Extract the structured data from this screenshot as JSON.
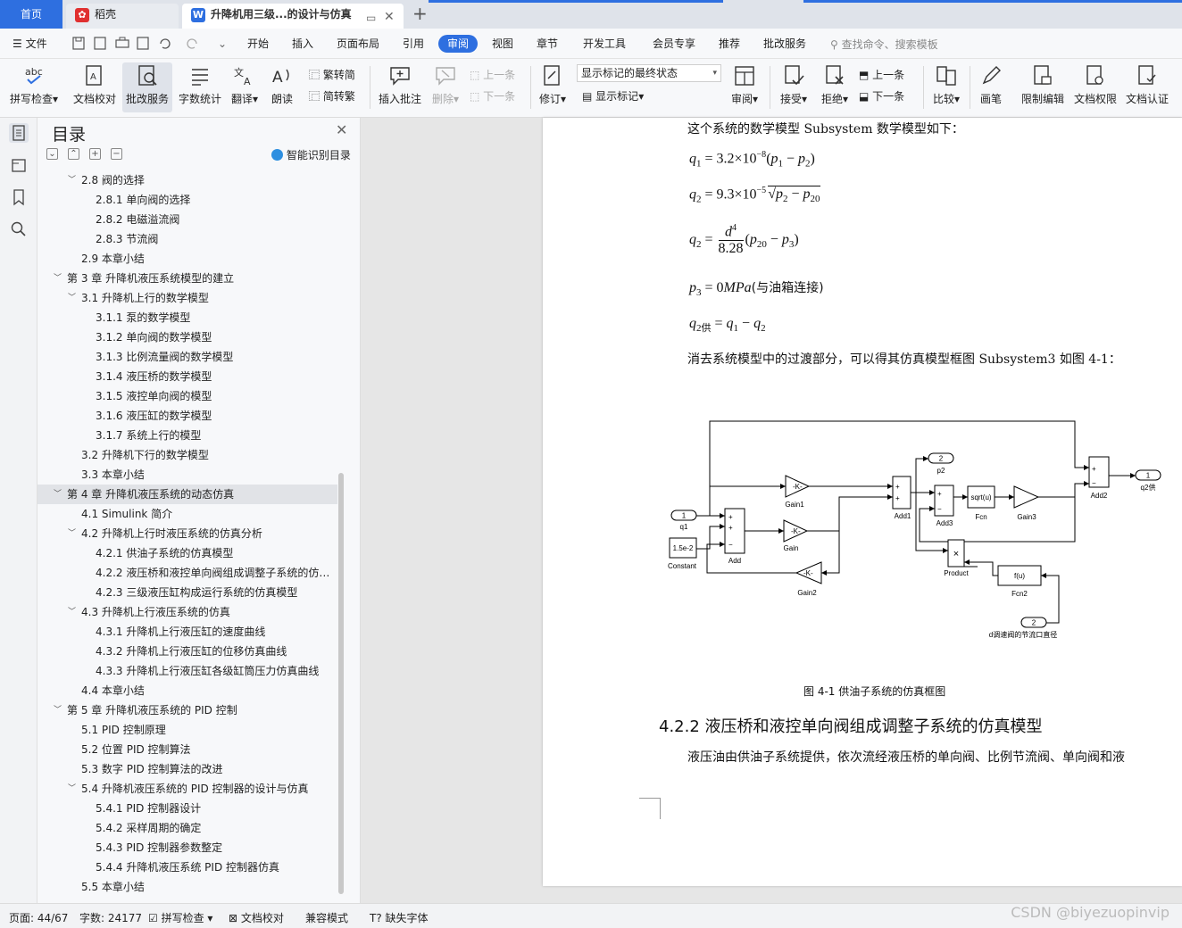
{
  "tabs": {
    "home": "首页",
    "daoke": "稻壳",
    "doc": "升降机用三级...的设计与仿真",
    "add": "+"
  },
  "menu": {
    "file": "文件",
    "items": [
      "开始",
      "插入",
      "页面布局",
      "引用",
      "审阅",
      "视图",
      "章节",
      "开发工具",
      "会员专享",
      "推荐",
      "批改服务"
    ],
    "active": "审阅",
    "search": "查找命令、搜索模板"
  },
  "ribbon": {
    "spell_check": "拼写检查",
    "doc_proof": "文档校对",
    "correction": "批改服务",
    "word_count": "字数统计",
    "translate": "翻译",
    "read_aloud": "朗读",
    "to_traditional": "繁转简",
    "to_simplified": "简转繁",
    "insert_comment": "插入批注",
    "delete": "删除",
    "prev": "上一条",
    "next": "下一条",
    "track": "修订",
    "markup_state": "显示标记的最终状态",
    "show_markup": "显示标记",
    "review": "审阅",
    "accept": "接受",
    "reject": "拒绝",
    "prev2": "上一条",
    "next2": "下一条",
    "compare": "比较",
    "pen": "画笔",
    "restrict_edit": "限制编辑",
    "doc_rights": "文档权限",
    "doc_cert": "文档认证"
  },
  "toc": {
    "title": "目录",
    "ai_toc": "智能识别目录",
    "items": [
      {
        "text": "2.8  阀的选择",
        "level": 2,
        "chev": true
      },
      {
        "text": "2.8.1  单向阀的选择",
        "level": 3
      },
      {
        "text": "2.8.2  电磁溢流阀",
        "level": 3
      },
      {
        "text": "2.8.3  节流阀",
        "level": 3
      },
      {
        "text": "2.9  本章小结",
        "level": 2
      },
      {
        "text": "第 3 章  升降机液压系统模型的建立",
        "level": 1,
        "chev": true
      },
      {
        "text": "3.1 升降机上行的数学模型",
        "level": 2,
        "chev": true
      },
      {
        "text": "3.1.1  泵的数学模型",
        "level": 3
      },
      {
        "text": "3.1.2  单向阀的数学模型",
        "level": 3
      },
      {
        "text": "3.1.3  比例流量阀的数学模型",
        "level": 3
      },
      {
        "text": "3.1.4  液压桥的数学模型",
        "level": 3
      },
      {
        "text": "3.1.5  液控单向阀的模型",
        "level": 3
      },
      {
        "text": "3.1.6  液压缸的数学模型",
        "level": 3
      },
      {
        "text": "3.1.7  系统上行的模型",
        "level": 3
      },
      {
        "text": "3.2  升降机下行的数学模型",
        "level": 2
      },
      {
        "text": "3.3  本章小结",
        "level": 2
      },
      {
        "text": "第 4 章  升降机液压系统的动态仿真",
        "level": 1,
        "chev": true,
        "selected": true
      },
      {
        "text": "4.1 Simulink 简介",
        "level": 2
      },
      {
        "text": "4.2 升降机上行时液压系统的仿真分析",
        "level": 2,
        "chev": true
      },
      {
        "text": "4.2.1  供油子系统的仿真模型",
        "level": 3
      },
      {
        "text": "4.2.2  液压桥和液控单向阀组成调整子系统的仿真模型",
        "level": 3
      },
      {
        "text": "4.2.3  三级液压缸构成运行系统的仿真模型",
        "level": 3
      },
      {
        "text": "4.3  升降机上行液压系统的仿真",
        "level": 2,
        "chev": true
      },
      {
        "text": "4.3.1  升降机上行液压缸的速度曲线",
        "level": 3
      },
      {
        "text": "4.3.2  升降机上行液压缸的位移仿真曲线",
        "level": 3
      },
      {
        "text": "4.3.3  升降机上行液压缸各级缸筒压力仿真曲线",
        "level": 3
      },
      {
        "text": "4.4  本章小结",
        "level": 2
      },
      {
        "text": "第 5 章  升降机液压系统的 PID 控制",
        "level": 1,
        "chev": true
      },
      {
        "text": "5.1 PID 控制原理",
        "level": 2
      },
      {
        "text": "5.2  位置 PID 控制算法",
        "level": 2
      },
      {
        "text": "5.3  数字 PID 控制算法的改进",
        "level": 2
      },
      {
        "text": "5.4  升降机液压系统的 PID 控制器的设计与仿真",
        "level": 2,
        "chev": true
      },
      {
        "text": "5.4.1 PID 控制器设计",
        "level": 3
      },
      {
        "text": "5.4.2  采样周期的确定",
        "level": 3
      },
      {
        "text": "5.4.3 PID 控制器参数整定",
        "level": 3
      },
      {
        "text": "5.4.4  升降机液压系统 PID 控制器仿真",
        "level": 3
      },
      {
        "text": "5.5  本章小结",
        "level": 2
      }
    ]
  },
  "document": {
    "intro": "这个系统的数学模型 Subsystem 数学模型如下：",
    "eq_p3_note": "(与油箱连接)",
    "para_after": "消去系统模型中的过渡部分，可以得其仿真模型框图 Subsystem3 如图 4-1：",
    "caption": "图 4-1  供油子系统的仿真框图",
    "heading": "4.2.2  液压桥和液控单向阀组成调整子系统的仿真模型",
    "para_last": "液压油由供油子系统提供，依次流经液压桥的单向阀、比例节流阀、单向阀和液",
    "diagram": {
      "in1_num": "1",
      "in1_label": "q1",
      "const_val": "1.5e-2",
      "const_label": "Constant",
      "add_label": "Add",
      "gain1": "-K-",
      "gain1_label": "Gain1",
      "gain_mid": "-K-",
      "gain_label": "Gain",
      "gain2": "-K-",
      "gain2_label": "Gain2",
      "add1_label": "Add1",
      "add3_label": "Add3",
      "out2_num": "2",
      "out2_label": "p2",
      "fcn": "sqrt(u)",
      "fcn_label": "Fcn",
      "gain3_label": "Gain3",
      "product_label": "Product",
      "fcn2": "f(u)",
      "fcn2_label": "Fcn2",
      "in2_num": "2",
      "in2_label": "d调速阀的节流口直径",
      "add2_label": "Add2",
      "out1_num": "1",
      "out1_label": "q2供"
    }
  },
  "status": {
    "page": "页面: 44/67",
    "words": "字数: 24177",
    "spell": "拼写检查",
    "proof": "文档校对",
    "compat": "兼容模式",
    "missing_font": "缺失字体",
    "watermark": "CSDN @biyezuopinvip"
  }
}
